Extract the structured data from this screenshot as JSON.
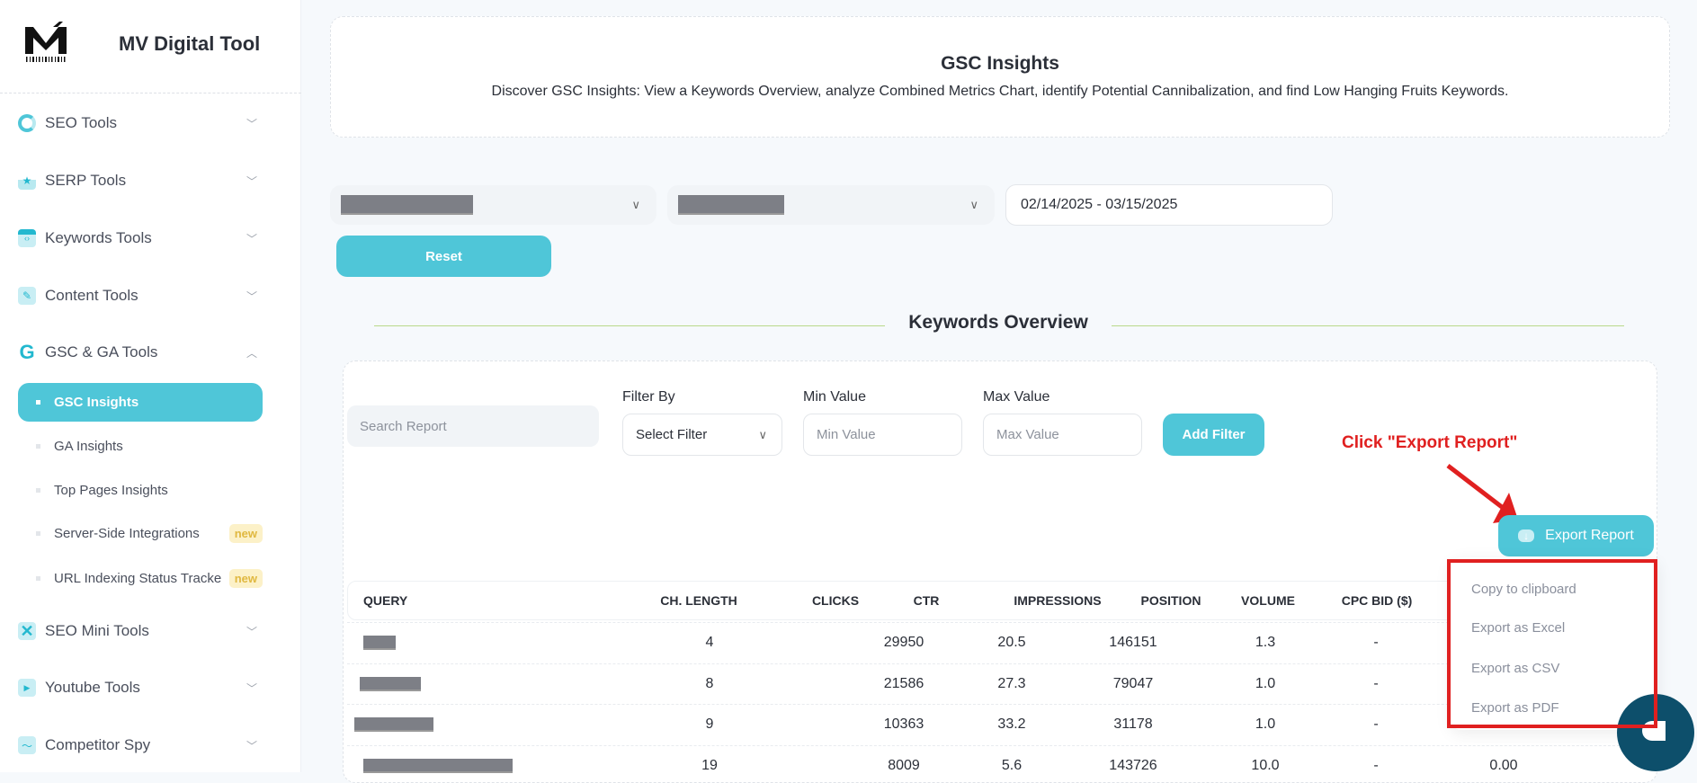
{
  "sidebar": {
    "brand": "MV Digital Tool",
    "logo_text": "M",
    "items": [
      {
        "label": "SEO Tools",
        "icon": "donut-chart-icon"
      },
      {
        "label": "SERP Tools",
        "icon": "podium-icon"
      },
      {
        "label": "Keywords Tools",
        "icon": "code-window-icon"
      },
      {
        "label": "Content Tools",
        "icon": "pen-icon"
      },
      {
        "label": "GSC & GA Tools",
        "icon": "google-g-icon"
      },
      {
        "label": "SEO Mini Tools",
        "icon": "tools-icon"
      },
      {
        "label": "Youtube Tools",
        "icon": "play-icon"
      },
      {
        "label": "Competitor Spy",
        "icon": "trend-icon"
      }
    ],
    "subitems": [
      {
        "label": "GSC Insights",
        "active": true
      },
      {
        "label": "GA Insights"
      },
      {
        "label": "Top Pages Insights"
      },
      {
        "label": "Server-Side Integrations",
        "badge": "new"
      },
      {
        "label": "URL Indexing Status Tracke",
        "badge": "new"
      }
    ]
  },
  "header": {
    "title": "GSC Insights",
    "subtitle": "Discover GSC Insights: View a Keywords Overview, analyze Combined Metrics Chart, identify Potential Cannibalization, and find Low Hanging Fruits Keywords."
  },
  "filters": {
    "date_range": "02/14/2025 - 03/15/2025",
    "reset_label": "Reset"
  },
  "overview": {
    "title": "Keywords Overview",
    "search_placeholder": "Search Report",
    "filter_by_label": "Filter By",
    "filter_select": "Select Filter",
    "min_label": "Min Value",
    "min_placeholder": "Min Value",
    "max_label": "Max Value",
    "max_placeholder": "Max Value",
    "add_filter": "Add Filter",
    "export_label": "Export Report",
    "annotation": "Click \"Export Report\"",
    "export_menu": [
      "Copy to clipboard",
      "Export as Excel",
      "Export as CSV",
      "Export as PDF"
    ]
  },
  "table": {
    "columns": [
      "QUERY",
      "CH. LENGTH",
      "CLICKS",
      "CTR",
      "IMPRESSIONS",
      "POSITION",
      "VOLUME",
      "CPC BID ($)"
    ],
    "rows": [
      [
        "4",
        "29950",
        "20.5",
        "146151",
        "1.3",
        "-",
        ""
      ],
      [
        "8",
        "21586",
        "27.3",
        "79047",
        "1.0",
        "-",
        ""
      ],
      [
        "9",
        "10363",
        "33.2",
        "31178",
        "1.0",
        "-",
        ""
      ],
      [
        "19",
        "8009",
        "5.6",
        "143726",
        "10.0",
        "-",
        "0.00"
      ]
    ]
  },
  "colors": {
    "accent": "#4fc6d8",
    "annotation": "#e02020",
    "chat": "#0d4f6b"
  }
}
